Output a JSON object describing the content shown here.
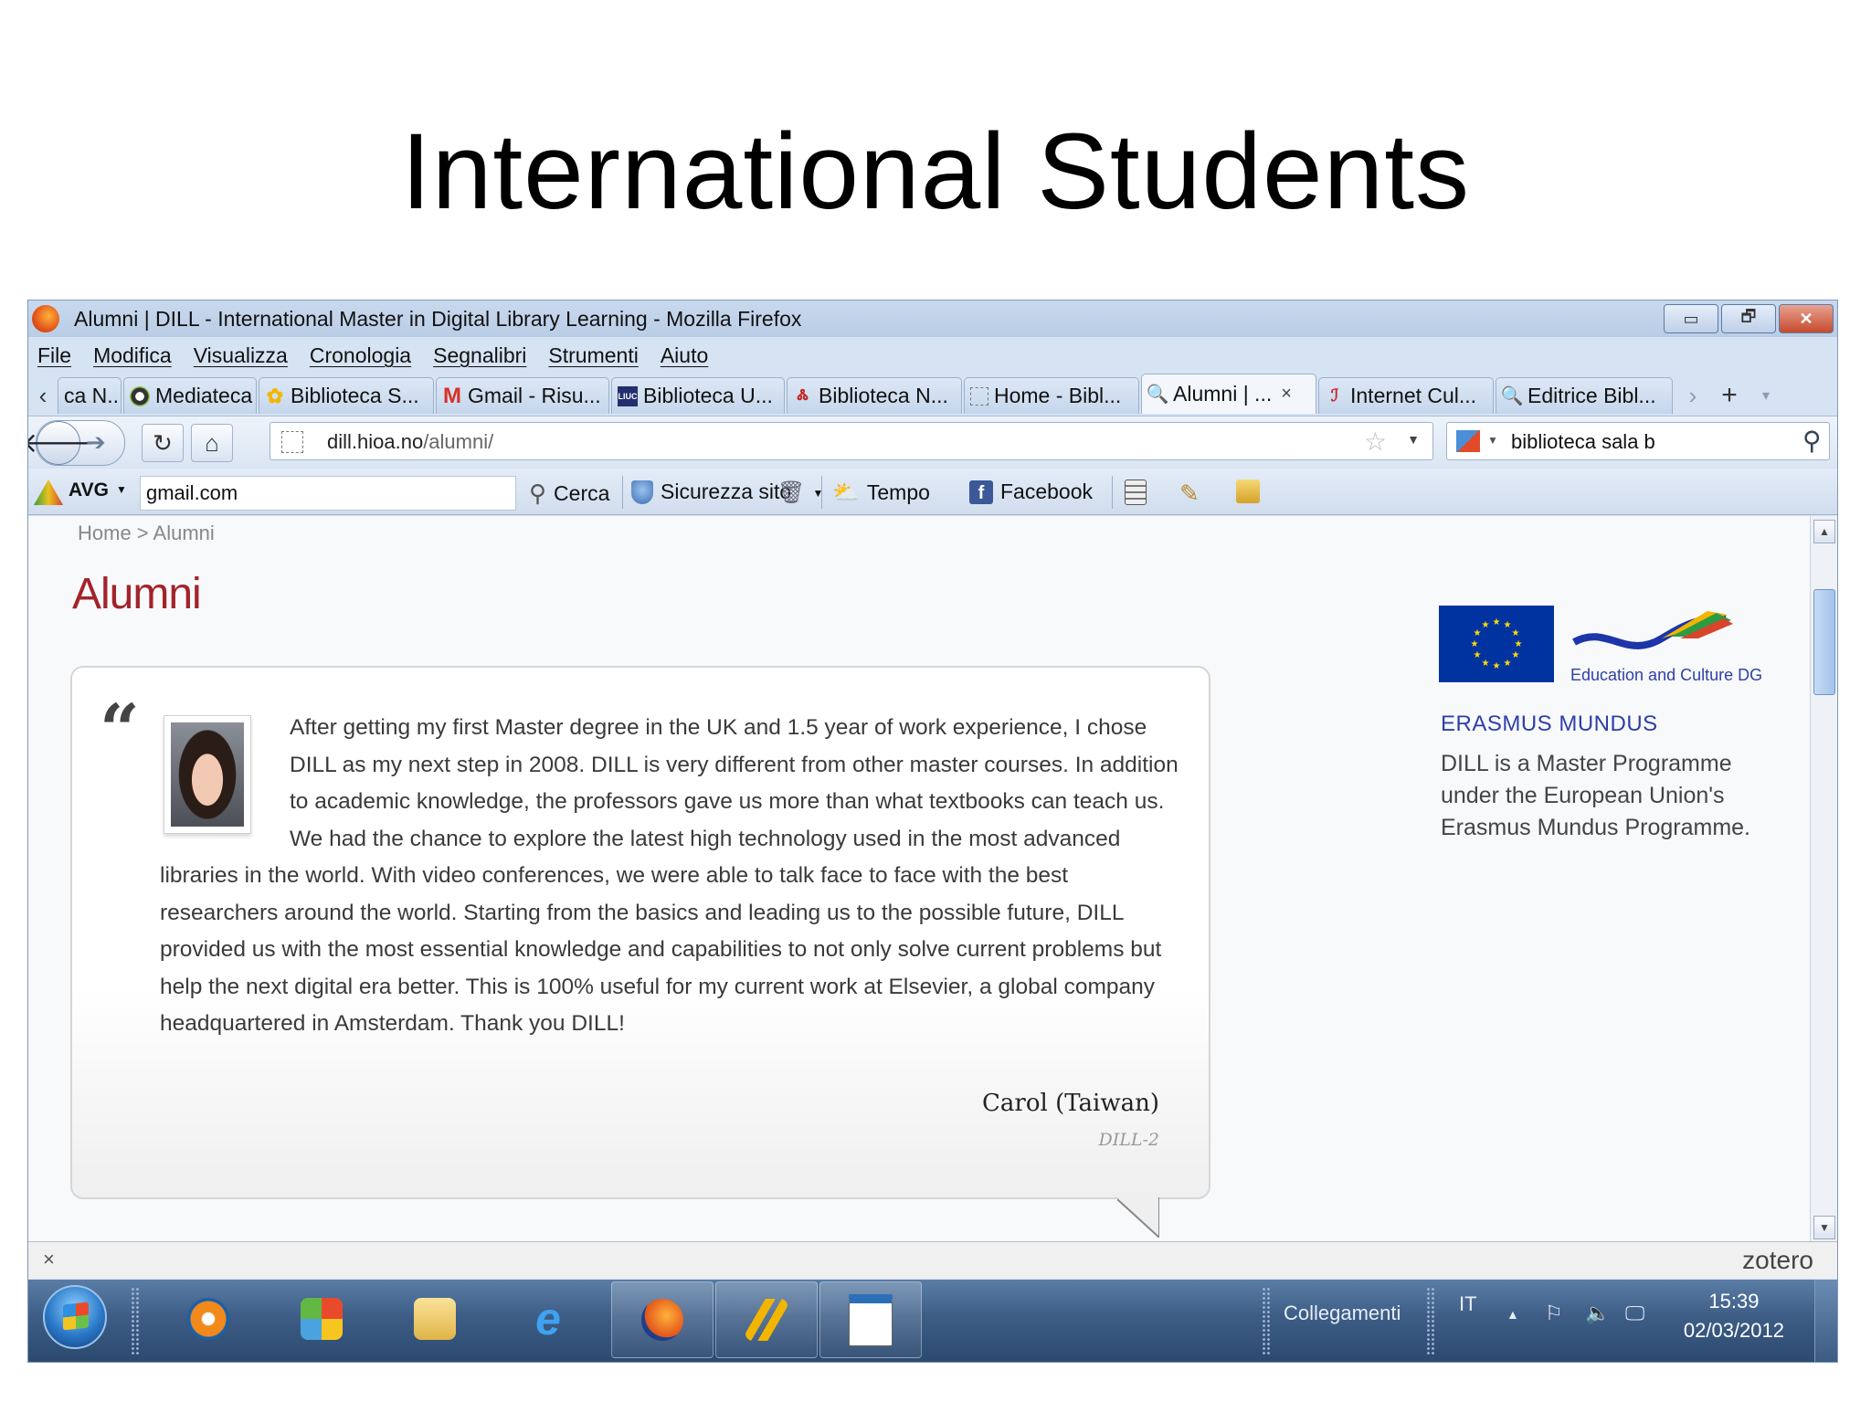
{
  "slide": {
    "title": "International Students"
  },
  "window": {
    "title": "Alumni | DILL - International Master in Digital Library Learning - Mozilla Firefox",
    "buttons": {
      "minimize": "▭",
      "restore": "🗗",
      "close": "✕"
    }
  },
  "menu": [
    "File",
    "Modifica",
    "Visualizza",
    "Cronologia",
    "Segnalibri",
    "Strumenti",
    "Aiuto"
  ],
  "tabs": [
    {
      "label": "ca N...",
      "icon": "none"
    },
    {
      "label": "Mediateca S...",
      "icon": "mediateca-icon"
    },
    {
      "label": "Biblioteca S...",
      "icon": "yellow-flower-icon"
    },
    {
      "label": "Gmail - Risu...",
      "icon": "gmail-icon"
    },
    {
      "label": "Biblioteca U...",
      "icon": "liuc-icon"
    },
    {
      "label": "Biblioteca N...",
      "icon": "biblioteca-icon"
    },
    {
      "label": "Home - Bibl...",
      "icon": "blank-page-icon"
    },
    {
      "label": "Alumni | ...",
      "icon": "magnifier-icon",
      "active": true
    },
    {
      "label": "Internet Cul...",
      "icon": "internet-culturale-icon"
    },
    {
      "label": "Editrice Bibl...",
      "icon": "magnifier-icon"
    }
  ],
  "tabbar": {
    "scroll_left": "‹",
    "scroll_right": "›",
    "new_tab": "+",
    "list": "▾",
    "close_tab": "×"
  },
  "nav": {
    "url_domain": "dill.hioa.no",
    "url_path": "/alumni/",
    "search_value": "biblioteca sala b"
  },
  "avg_toolbar": {
    "brand": "AVG",
    "search_value": "gmail.com",
    "search_label": "Cerca",
    "site_safety_label": "Sicurezza sito",
    "weather_label": "Tempo",
    "facebook_label": "Facebook"
  },
  "page": {
    "breadcrumb": "Home > Alumni",
    "heading": "Alumni",
    "quote_mark": "“",
    "testimonial": "After getting my first Master degree in the UK and 1.5 year of work experience, I chose DILL as my next step in 2008. DILL is very different from other master courses. In addition to academic knowledge, the professors gave us more than what textbooks can teach us. We had the chance to explore the latest high technology used in the most advanced libraries in the world. With video conferences, we were able to talk face to face with the best researchers around the world. Starting from the basics and leading us to the possible future, DILL provided us with the most essential knowledge and capabilities to not only solve current problems but help the next digital era better. This is 100% useful for my current work at Elsevier, a global company headquartered in Amsterdam. Thank you DILL!",
    "author": "Carol (Taiwan)",
    "cohort": "DILL-2",
    "sidebar": {
      "dg_label": "Education and Culture DG",
      "erasmus_label": "ERASMUS MUNDUS",
      "description": "DILL is a Master Programme under the European Union's Erasmus Mundus Programme."
    }
  },
  "zotero": {
    "close": "×",
    "label": "zotero"
  },
  "taskbar": {
    "links_label": "Collegamenti",
    "language": "IT",
    "time": "15:39",
    "date": "02/03/2012"
  },
  "colors": {
    "heading_red": "#a3232a",
    "eu_blue": "#0033a0",
    "erasmus_blue": "#2f3fa8"
  }
}
